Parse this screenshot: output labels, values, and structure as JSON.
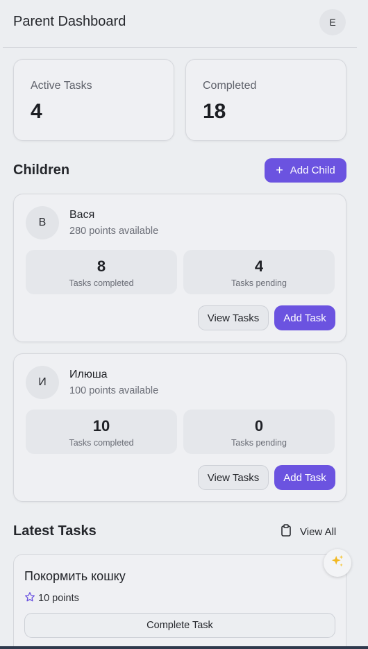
{
  "header": {
    "title": "Parent Dashboard",
    "avatar_initial": "E"
  },
  "stats": [
    {
      "label": "Active Tasks",
      "value": "4"
    },
    {
      "label": "Completed",
      "value": "18"
    }
  ],
  "children_section": {
    "title": "Children",
    "add_child_label": "Add Child"
  },
  "children": [
    {
      "initial": "В",
      "name": "Вася",
      "points": "280 points available",
      "tasks_completed": "8",
      "tasks_completed_label": "Tasks completed",
      "tasks_pending": "4",
      "tasks_pending_label": "Tasks pending",
      "view_tasks_label": "View Tasks",
      "add_task_label": "Add Task"
    },
    {
      "initial": "И",
      "name": "Илюша",
      "points": "100 points available",
      "tasks_completed": "10",
      "tasks_completed_label": "Tasks completed",
      "tasks_pending": "0",
      "tasks_pending_label": "Tasks pending",
      "view_tasks_label": "View Tasks",
      "add_task_label": "Add Task"
    }
  ],
  "latest_tasks": {
    "title": "Latest Tasks",
    "view_all_label": "View All",
    "items": [
      {
        "title": "Покормить кошку",
        "points": "10 points",
        "complete_label": "Complete Task"
      }
    ]
  },
  "colors": {
    "accent": "#6b53e0",
    "background": "#eceef1",
    "card": "#eff0f3"
  },
  "icons": {
    "add": "plus-icon",
    "view_all": "clipboard-icon",
    "points": "star-icon",
    "assistant": "sparkles-icon"
  }
}
